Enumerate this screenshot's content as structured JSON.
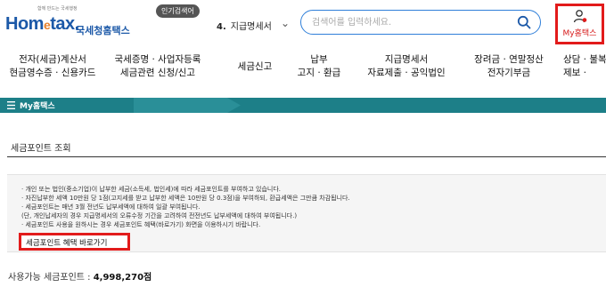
{
  "header": {
    "logo_tagline": "함께 만드는 국세행정",
    "logo_home": "Hom",
    "logo_e": "e",
    "logo_tax": "tax.",
    "logo_kname": "국세청홈택스",
    "popular_badge": "인기검색어",
    "popular_rank": "4.",
    "popular_term": "지급명세서",
    "search_placeholder": "검색어를 입력하세요.",
    "my_label": "My홈택스"
  },
  "nav": {
    "items": [
      {
        "line1": "전자(세금)계산서",
        "line2": "현금영수증 · 신용카드"
      },
      {
        "line1": "국세증명 · 사업자등록",
        "line2": "세금관련 신청/신고"
      },
      {
        "line1": "세금신고",
        "line2": ""
      },
      {
        "line1": "납부",
        "line2": "고지 · 환급"
      },
      {
        "line1": "지급명세서",
        "line2": "자료제출 · 공익법인"
      },
      {
        "line1": "장려금 · 연말정산",
        "line2": "전자기부금"
      },
      {
        "line1": "상담 · 불복",
        "line2": "제보 ·"
      }
    ]
  },
  "bar": {
    "title": "My홈택스"
  },
  "page": {
    "title": "세금포인트 조회",
    "info_lines": [
      "· 개인 또는 법인(중소기업)이 납부한 세금(소득세, 법인세)에 따라 세금포인트를 부여하고 있습니다.",
      "· 자진납부한 세액 10만원 당 1점(고지세를 받고 납부한 세액은 10만원 당 0.3점)을 부여하되, 환급세액은 그만큼 차감됩니다.",
      "· 세금포인트는 매년 3월 전년도 납부세액에 대하여 일괄 부여됩니다.",
      "  (단, 개인납세자의 경우 지급명세서의 오류수정 기간을 고려하여 전전년도 납부세액에 대하여 부여됩니다.)",
      "· 세금포인트 사용을 원하시는 경우 세금포인트 혜택(바로가기) 화면을 이용하시기 바랍니다."
    ],
    "highlight": "(바로가기)",
    "shortcut_label": "세금포인트 혜택 바로가기",
    "points_label": "사용가능 세금포인트 :",
    "points_value": "4,998,270점"
  },
  "colors": {
    "brand_blue": "#1c59a8",
    "teal_bar": "#1d7f88",
    "highlight_red": "#e21b1b"
  }
}
